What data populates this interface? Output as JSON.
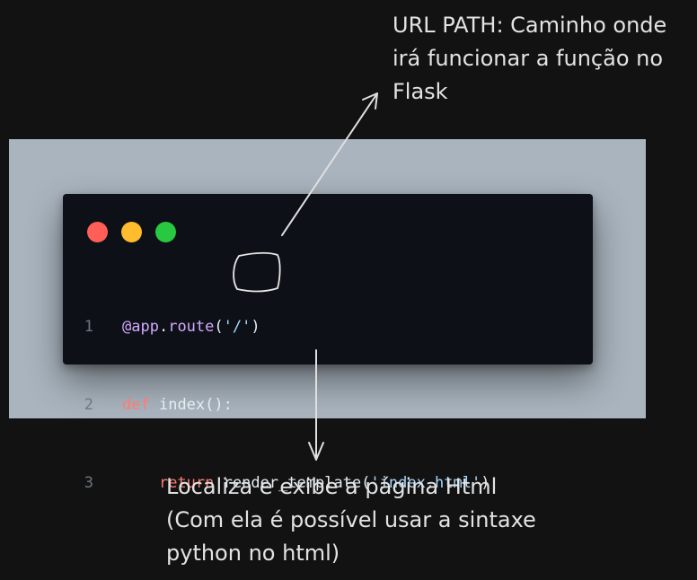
{
  "annotations": {
    "url_path": [
      "URL PATH: Caminho onde",
      "irá funcionar a função no",
      "Flask"
    ],
    "render": [
      "Localiza e exibe a página Html",
      "(Com ela é possível usar a sintaxe",
      "python no html)"
    ]
  },
  "code": {
    "line_numbers": [
      "1",
      "2",
      "3"
    ],
    "line1": {
      "decorator": "@app",
      "dot": ".",
      "attr": "route",
      "open": "(",
      "string": "'/'",
      "close": ")"
    },
    "line2": {
      "keyword": "def",
      "name": "index",
      "rest": "():"
    },
    "line3": {
      "indent": "    ",
      "keyword": "return",
      "func": "render_template",
      "open": "(",
      "string": "'index.html'",
      "close": ")"
    }
  },
  "colors": {
    "background": "#121212",
    "backdrop": "#a9b4be",
    "editor": "#0d1117",
    "traffic_red": "#ff5f57",
    "traffic_yellow": "#febc2e",
    "traffic_green": "#28c840",
    "keyword": "#ff7b72",
    "decorator": "#d2a8ff",
    "string": "#a5d6ff",
    "plain": "#e6edf3",
    "annotation_text": "#e3e3e3"
  },
  "icons": {
    "traffic_lights": [
      "close-dot",
      "minimize-dot",
      "maximize-dot"
    ]
  }
}
